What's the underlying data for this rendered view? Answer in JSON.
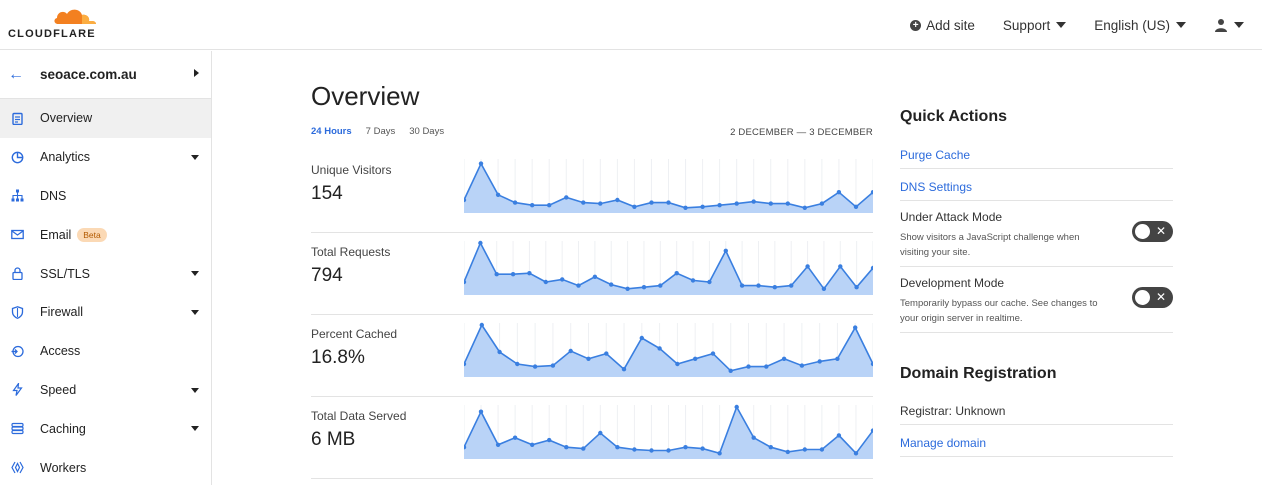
{
  "brand": {
    "name": "CLOUDFLARE",
    "accent": "#f38020",
    "link_color": "#2c6bdc"
  },
  "topnav": {
    "add_site": "Add site",
    "support": "Support",
    "language": "English (US)"
  },
  "sidebar": {
    "site": "seoace.com.au",
    "items": [
      {
        "label": "Overview",
        "icon": "clipboard-icon",
        "active": true
      },
      {
        "label": "Analytics",
        "icon": "pie-chart-icon",
        "caret": true
      },
      {
        "label": "DNS",
        "icon": "network-icon"
      },
      {
        "label": "Email",
        "icon": "envelope-icon",
        "badge": "Beta"
      },
      {
        "label": "SSL/TLS",
        "icon": "lock-icon",
        "caret": true
      },
      {
        "label": "Firewall",
        "icon": "shield-icon",
        "caret": true
      },
      {
        "label": "Access",
        "icon": "access-icon"
      },
      {
        "label": "Speed",
        "icon": "lightning-icon",
        "caret": true
      },
      {
        "label": "Caching",
        "icon": "database-icon",
        "caret": true
      },
      {
        "label": "Workers",
        "icon": "workers-icon"
      }
    ]
  },
  "main": {
    "title": "Overview",
    "tabs": [
      {
        "label": "24 Hours",
        "active": true
      },
      {
        "label": "7 Days"
      },
      {
        "label": "30 Days"
      }
    ],
    "date_range": "2 DECEMBER — 3 DECEMBER",
    "metrics": [
      {
        "label": "Unique Visitors",
        "value": "154"
      },
      {
        "label": "Total Requests",
        "value": "794"
      },
      {
        "label": "Percent Cached",
        "value": "16.8%"
      },
      {
        "label": "Total Data Served",
        "value": "6 MB"
      }
    ]
  },
  "chart_data": [
    {
      "type": "area",
      "series": [
        {
          "values": [
            0.25,
            0.95,
            0.35,
            0.2,
            0.15,
            0.15,
            0.3,
            0.2,
            0.18,
            0.25,
            0.12,
            0.2,
            0.2,
            0.1,
            0.12,
            0.15,
            0.18,
            0.22,
            0.18,
            0.18,
            0.1,
            0.18,
            0.4,
            0.12,
            0.4
          ]
        }
      ]
    },
    {
      "type": "area",
      "series": [
        {
          "values": [
            0.25,
            1.0,
            0.4,
            0.4,
            0.42,
            0.25,
            0.3,
            0.18,
            0.35,
            0.2,
            0.12,
            0.15,
            0.18,
            0.42,
            0.28,
            0.25,
            0.85,
            0.18,
            0.18,
            0.15,
            0.18,
            0.55,
            0.12,
            0.55,
            0.15,
            0.52
          ]
        }
      ]
    },
    {
      "type": "area",
      "series": [
        {
          "values": [
            0.25,
            1.0,
            0.48,
            0.25,
            0.2,
            0.22,
            0.5,
            0.35,
            0.45,
            0.15,
            0.75,
            0.55,
            0.25,
            0.35,
            0.45,
            0.12,
            0.2,
            0.2,
            0.35,
            0.22,
            0.3,
            0.35,
            0.95,
            0.25
          ]
        }
      ]
    },
    {
      "type": "area",
      "series": [
        {
          "values": [
            0.25,
            1.0,
            0.3,
            0.45,
            0.3,
            0.4,
            0.25,
            0.22,
            0.55,
            0.25,
            0.2,
            0.18,
            0.18,
            0.25,
            0.22,
            0.12,
            1.1,
            0.45,
            0.25,
            0.15,
            0.2,
            0.2,
            0.5,
            0.12,
            0.6
          ]
        }
      ]
    }
  ],
  "right": {
    "quick_actions_title": "Quick Actions",
    "purge_cache": "Purge Cache",
    "dns_settings": "DNS Settings",
    "under_attack_title": "Under Attack Mode",
    "under_attack_desc": "Show visitors a JavaScript challenge when visiting your site.",
    "dev_mode_title": "Development Mode",
    "dev_mode_desc": "Temporarily bypass our cache. See changes to your origin server in realtime.",
    "domain_reg_title": "Domain Registration",
    "registrar": "Registrar: Unknown",
    "manage_domain": "Manage domain"
  }
}
